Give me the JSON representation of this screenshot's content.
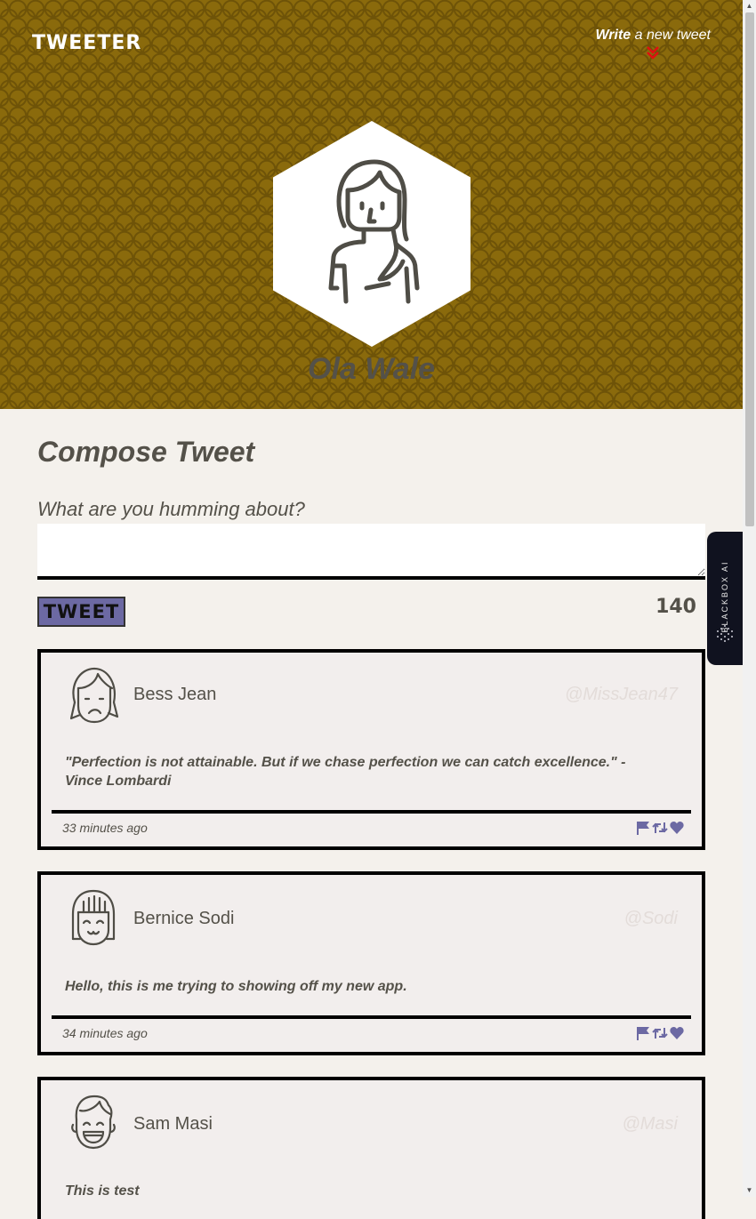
{
  "header": {
    "brand": "TWEETER",
    "nav_write_bold": "Write",
    "nav_write_rest": " a new tweet",
    "nav_chevron": "»",
    "profile_name": "Ola Wale"
  },
  "compose": {
    "title": "Compose Tweet",
    "label": "What are you humming about?",
    "input_value": "",
    "button_label": "TWEET",
    "char_count": "140"
  },
  "tweets": [
    {
      "name": "Bess Jean",
      "handle": "@MissJean47",
      "text": "\"Perfection is not attainable. But if we chase perfection we can catch excellence.\" - Vince Lombardi",
      "time": "33 minutes ago",
      "avatar_icon": "sad-girl-avatar-icon"
    },
    {
      "name": "Bernice Sodi",
      "handle": "@Sodi",
      "text": "Hello, this is me trying to showing off my new app.",
      "time": "34 minutes ago",
      "avatar_icon": "happy-girl-avatar-icon"
    },
    {
      "name": "Sam Masi",
      "handle": "@Masi",
      "text": "This is test",
      "time": "",
      "avatar_icon": "laughing-boy-avatar-icon"
    }
  ],
  "actions": [
    "flag-icon",
    "retweet-icon",
    "heart-icon"
  ],
  "side_tab": {
    "label": "BLACKBOX AI"
  },
  "colors": {
    "header_bg": "#8a6a0c",
    "accent": "#6c69a3",
    "text": "#545149",
    "chevron": "#e01010"
  }
}
